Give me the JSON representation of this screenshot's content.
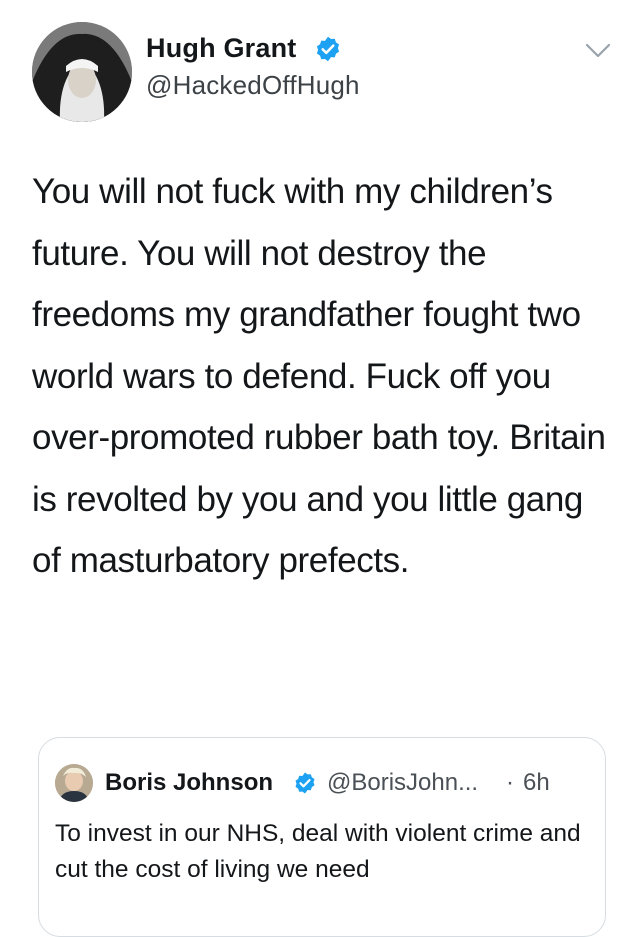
{
  "author": {
    "display_name": "Hugh Grant",
    "handle": "@HackedOffHugh",
    "verified": true,
    "avatar_icon": "avatar-nun-portrait"
  },
  "tweet": {
    "text": "You will not fuck with my children’s future. You will not destroy the freedoms my grandfather fought two world wars to defend. Fuck off you over-promoted rubber bath toy. Britain is revolted by you and you little gang of masturbatory prefects."
  },
  "quoted_tweet": {
    "display_name": "Boris Johnson",
    "handle": "@BorisJohn...",
    "separator": "·",
    "time": "6h",
    "verified": true,
    "text": "To invest in our NHS, deal with violent crime and cut the cost of living we need"
  },
  "icons": {
    "verified_color": "#1da1f2",
    "chevron": "chevron-down-icon"
  }
}
